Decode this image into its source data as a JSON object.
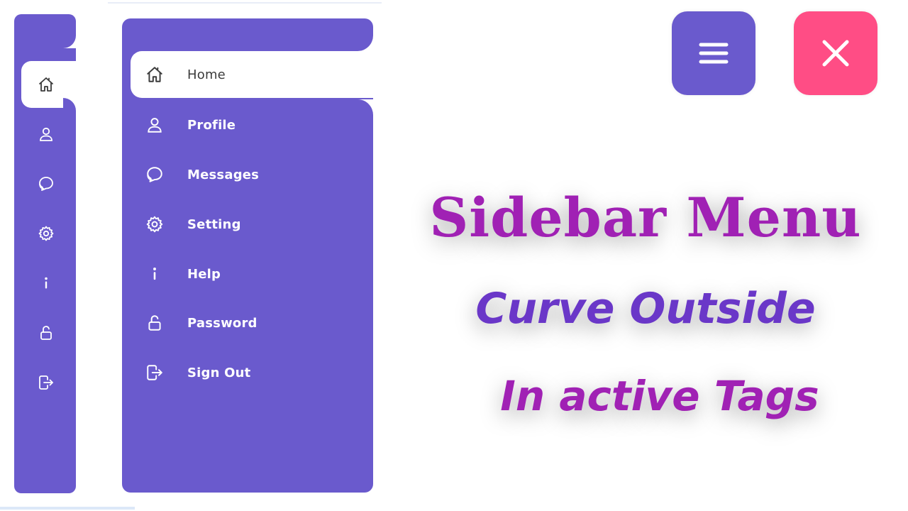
{
  "brand_colors": {
    "sidebar": "#6a5acd",
    "active_bg": "#ffffff",
    "menu_button": "#6a5acd",
    "close_button": "#ff4d85",
    "title_primary": "#a021b4",
    "title_secondary": "#6a37c8"
  },
  "collapsed_sidebar": {
    "active_item": "home",
    "items": [
      {
        "id": "home",
        "icon": "home-icon"
      },
      {
        "id": "profile",
        "icon": "user-icon"
      },
      {
        "id": "messages",
        "icon": "chat-icon"
      },
      {
        "id": "setting",
        "icon": "gear-icon"
      },
      {
        "id": "help",
        "icon": "info-icon"
      },
      {
        "id": "password",
        "icon": "lock-icon"
      },
      {
        "id": "signout",
        "icon": "sign-out-icon"
      }
    ]
  },
  "expanded_sidebar": {
    "active_item": "home",
    "items": [
      {
        "id": "home",
        "icon": "home-icon",
        "label": "Home"
      },
      {
        "id": "profile",
        "icon": "user-icon",
        "label": "Profile"
      },
      {
        "id": "messages",
        "icon": "chat-icon",
        "label": "Messages"
      },
      {
        "id": "setting",
        "icon": "gear-icon",
        "label": "Setting"
      },
      {
        "id": "help",
        "icon": "info-icon",
        "label": "Help"
      },
      {
        "id": "password",
        "icon": "lock-icon",
        "label": "Password"
      },
      {
        "id": "signout",
        "icon": "sign-out-icon",
        "label": "Sign Out"
      }
    ]
  },
  "buttons": {
    "menu_icon": "hamburger-icon",
    "close_icon": "close-icon"
  },
  "headline": {
    "line1": "Sidebar Menu",
    "line2": "Curve Outside",
    "line3": "In active Tags"
  }
}
